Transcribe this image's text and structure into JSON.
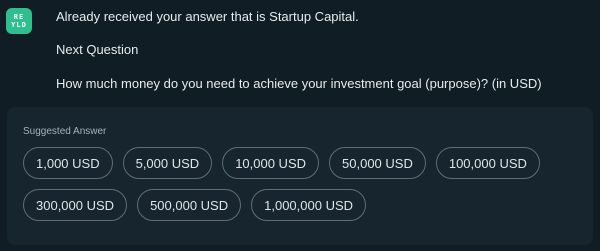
{
  "avatar": {
    "line1": "RE",
    "line2": "YLD"
  },
  "message": {
    "line1": "Already received your answer that is Startup Capital.",
    "line2": "Next Question",
    "line3": "How much money do you need to achieve your investment goal (purpose)? (in USD)"
  },
  "suggestions": {
    "label": "Suggested Answer",
    "options": [
      "1,000 USD",
      "5,000 USD",
      "10,000 USD",
      "50,000 USD",
      "100,000 USD",
      "300,000 USD",
      "500,000 USD",
      "1,000,000 USD"
    ]
  },
  "colors": {
    "background": "#101d25",
    "panel": "#16252e",
    "avatar": "#2fbf8f",
    "chip_border": "#5e6e77"
  }
}
